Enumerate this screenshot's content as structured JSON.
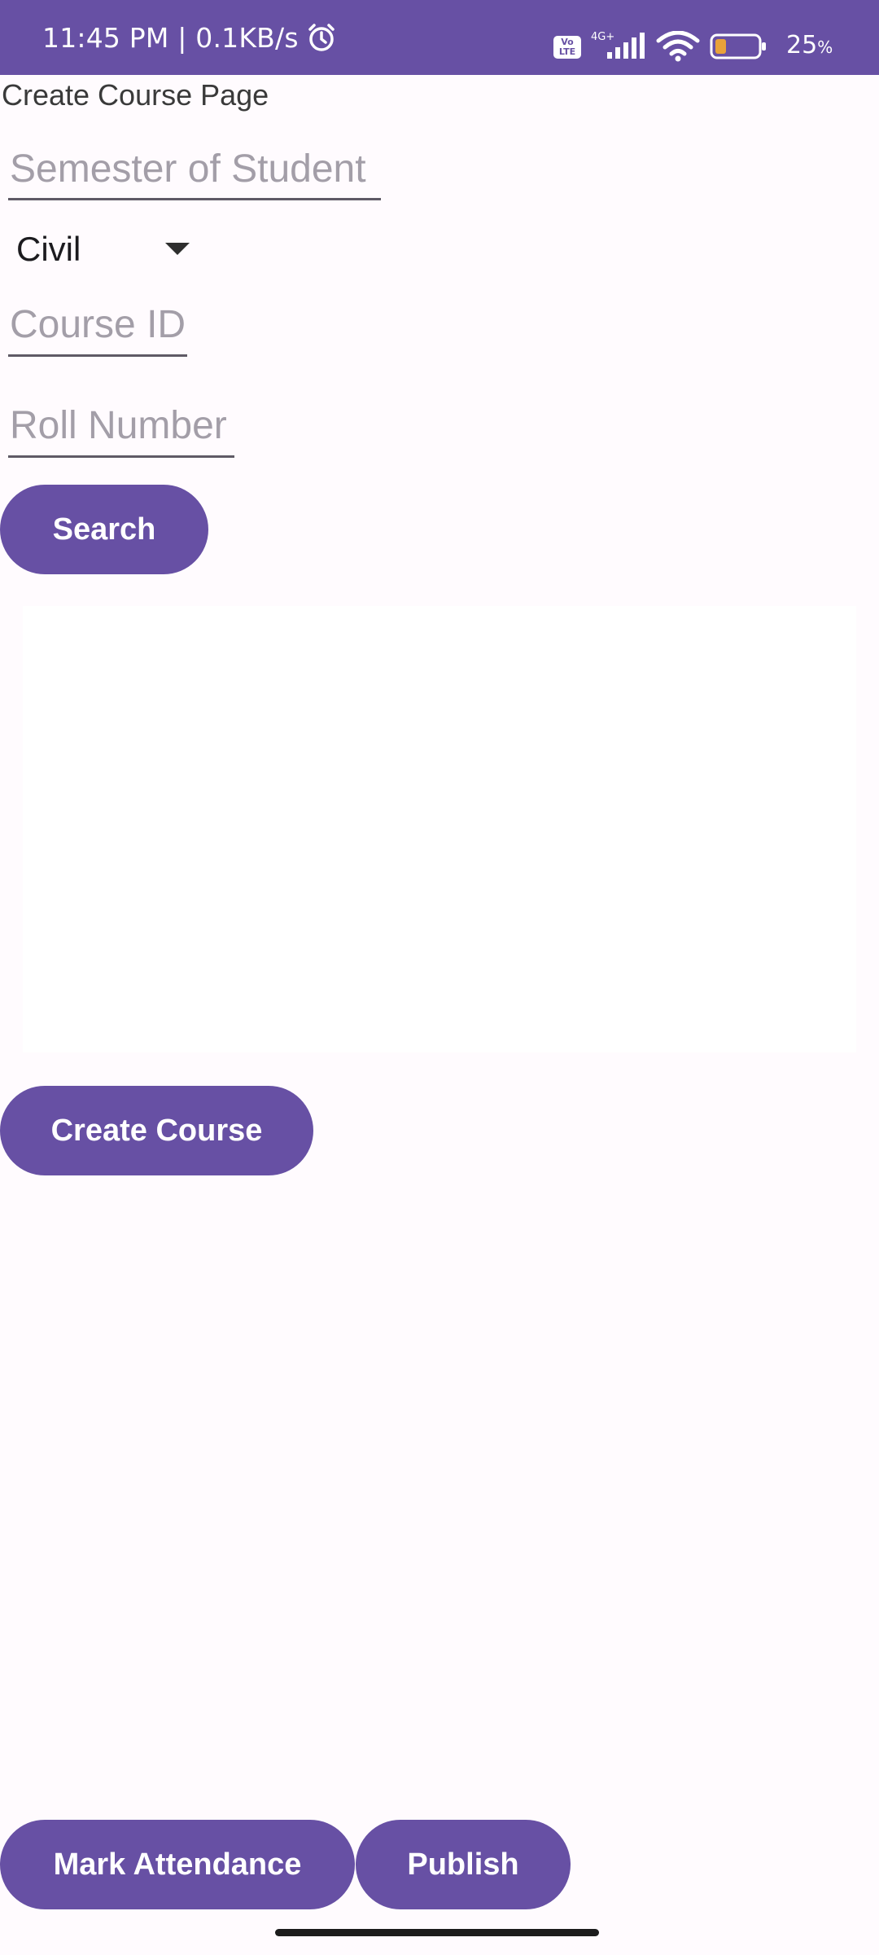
{
  "status_bar": {
    "time": "11:45 PM | 0.1KB/s",
    "volte_label": "Vo\nLTE",
    "network_type": "4G+",
    "battery_percent": "25",
    "battery_percent_sign": "%",
    "battery_level": 0.25,
    "background_color": "#6750a4",
    "icons": [
      "alarm-icon",
      "volte-icon",
      "signal-icon",
      "wifi-icon",
      "battery-icon"
    ]
  },
  "page": {
    "title": "Create Course Page"
  },
  "form": {
    "semester_placeholder": "Semester of Student",
    "department_selected": "Civil",
    "course_id_placeholder": "Course ID",
    "roll_number_placeholder": "Roll Number",
    "search_label": "Search"
  },
  "actions": {
    "create_course_label": "Create Course",
    "mark_attendance_label": "Mark Attendance",
    "publish_label": "Publish"
  },
  "theme": {
    "accent": "#6750a4",
    "background": "#fffbfe"
  }
}
